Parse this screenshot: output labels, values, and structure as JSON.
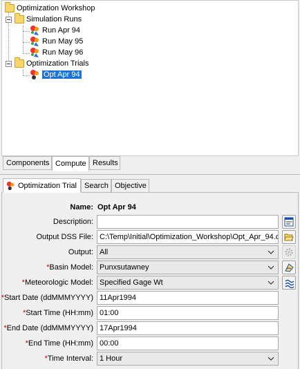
{
  "tree": {
    "root": "Optimization Workshop",
    "simulation_runs": {
      "label": "Simulation Runs",
      "items": [
        "Run Apr 94",
        "Run May 95",
        "Run May 96"
      ]
    },
    "optimization_trials": {
      "label": "Optimization Trials",
      "items": [
        "Opt Apr 94"
      ]
    },
    "selected": "Opt Apr 94"
  },
  "bottom_tabs": [
    "Components",
    "Compute",
    "Results"
  ],
  "active_bottom_tab": "Compute",
  "editor_tabs": [
    "Optimization Trial",
    "Search",
    "Objective"
  ],
  "active_editor_tab": "Optimization Trial",
  "form": {
    "name_label": "Name:",
    "name_value": "Opt Apr 94",
    "description_label": "Description:",
    "description_value": "",
    "dss_label": "Output DSS File:",
    "dss_value": "C:\\Temp\\Initial\\Optimization_Workshop\\Opt_Apr_94.d",
    "output_label": "Output:",
    "output_value": "All",
    "basin_label": "Basin Model:",
    "basin_value": "Punxsutawney",
    "met_label": "Meteorologic Model:",
    "met_value": "Specified Gage Wt",
    "start_date_label": "Start Date (ddMMMYYYY)",
    "start_date_value": "11Apr1994",
    "start_time_label": "Start Time (HH:mm)",
    "start_time_value": "01:00",
    "end_date_label": "End Date (ddMMMYYYY)",
    "end_date_value": "17Apr1994",
    "end_time_label": "End Time (HH:mm)",
    "end_time_value": "00:00",
    "interval_label": "Time Interval:",
    "interval_value": "1 Hour",
    "required_mark": "*"
  },
  "colors": {
    "selection": "#1a73d6",
    "required": "#c00000",
    "folder": "#f7d66b"
  },
  "icons": [
    "folder-icon",
    "run-icon",
    "trial-icon",
    "chevron-down-icon",
    "description-icon",
    "folder-open-icon",
    "gear-icon",
    "basin-model-icon",
    "met-model-icon"
  ]
}
